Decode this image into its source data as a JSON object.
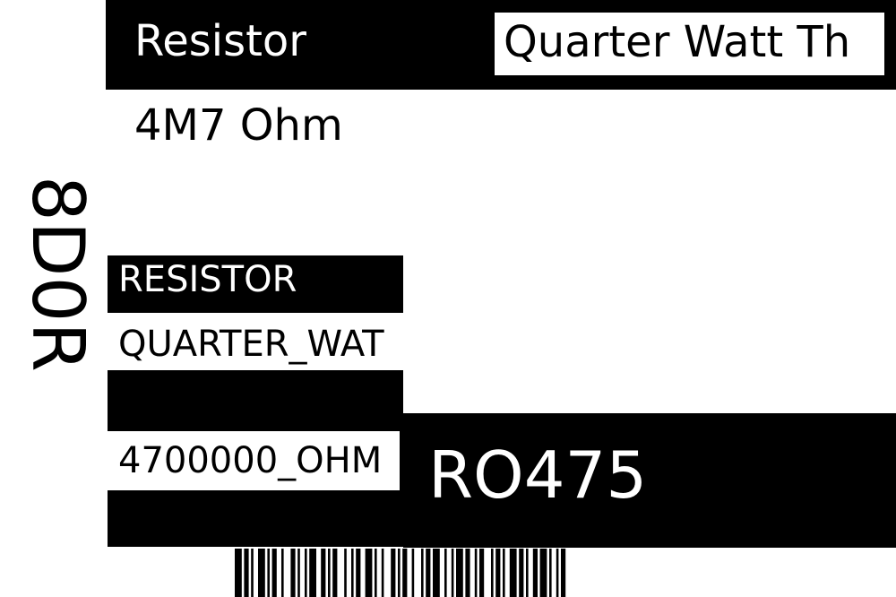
{
  "label": {
    "title": "Resistor",
    "subtitle": "Quarter Watt Th",
    "value": "4M7 Ohm",
    "vertical_code": "8D0R",
    "category": "RESISTOR",
    "power_rating": "QUARTER_WAT",
    "resistance_code": "4700000_OHM",
    "part_number": "RO475"
  },
  "barcode": {
    "bars": [
      3,
      1,
      2,
      1,
      1,
      2,
      3,
      1,
      1,
      1,
      2,
      2,
      1,
      3,
      2,
      1,
      1,
      2,
      1,
      1,
      3,
      2,
      2,
      1,
      1,
      1,
      2,
      3,
      1,
      2,
      1,
      1,
      2,
      2,
      3,
      1,
      1,
      2,
      1,
      3,
      2,
      1,
      1,
      1,
      2,
      2,
      1,
      3,
      1,
      1,
      2,
      1,
      3,
      2,
      1,
      2,
      1,
      1,
      3,
      1,
      2,
      2,
      1,
      1,
      2,
      3,
      1,
      1,
      2,
      1,
      1,
      2,
      3,
      1,
      2,
      1,
      1,
      2,
      2,
      1,
      3,
      1,
      1,
      2,
      1,
      1,
      2,
      3
    ]
  },
  "colors": {
    "ink": "#000000",
    "paper": "#ffffff"
  }
}
